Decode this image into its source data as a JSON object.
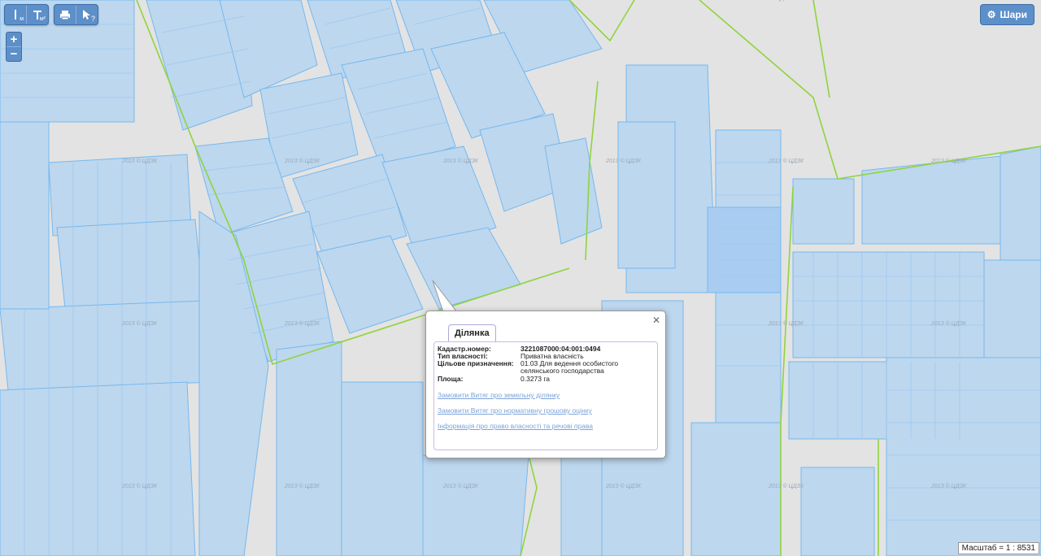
{
  "toolbar": {
    "measure_line_sub": "м",
    "measure_area_sub": "м²",
    "help_label": "?"
  },
  "zoom": {
    "in": "+",
    "out": "−"
  },
  "layers_button": {
    "label": "Шари"
  },
  "watermark": "2013 © ЦДЗК",
  "popup": {
    "tab_label": "Ділянка",
    "fields": [
      {
        "label": "Кадастр.номер:",
        "value": "3221087000:04:001:0494"
      },
      {
        "label": "Тип власності:",
        "value": "Приватна власність"
      },
      {
        "label": "Цільове призначення:",
        "value": "01.03 Для ведення особистого селянського господарства"
      },
      {
        "label": "Площа:",
        "value": "0.3273 га"
      }
    ],
    "links": [
      "Замовити Витяг про земельну ділянку",
      "Замовити Витяг про нормативну грошову оцінку",
      "Інформація про право власності та речові права"
    ]
  },
  "scale": {
    "label": "Масштаб = 1 : 8531"
  },
  "colors": {
    "parcel_fill": "#bdd7ee",
    "parcel_stroke": "#76b8ee",
    "boundary": "#8fd43c",
    "background": "#e3e3e3"
  }
}
